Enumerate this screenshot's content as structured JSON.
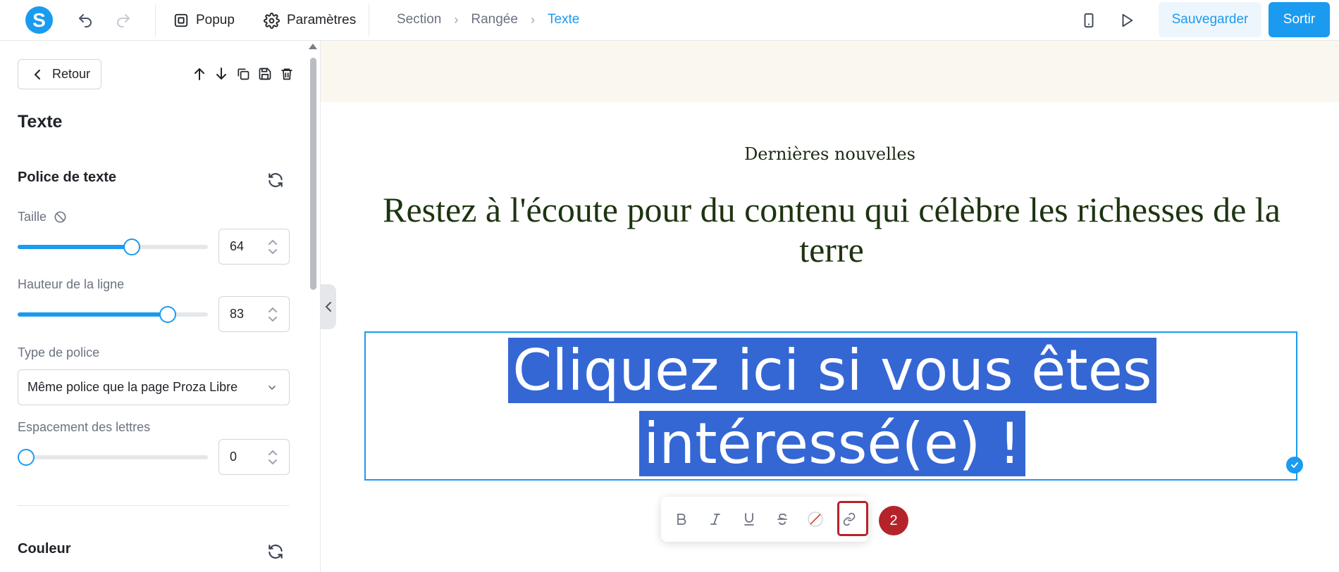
{
  "app": {
    "logo_letter": "S"
  },
  "toolbar": {
    "popup_label": "Popup",
    "settings_label": "Paramètres",
    "breadcrumb": [
      "Section",
      "Rangée",
      "Texte"
    ],
    "save_label": "Sauvegarder",
    "exit_label": "Sortir"
  },
  "panel": {
    "back_label": "Retour",
    "title": "Texte",
    "font_section": "Police de texte",
    "size_label": "Taille",
    "size_value": "64",
    "size_fraction": 0.6,
    "line_height_label": "Hauteur de la ligne",
    "line_height_value": "83",
    "line_height_fraction": 0.79,
    "font_type_label": "Type de police",
    "font_type_value": "Même police que la page Proza Libre",
    "letter_spacing_label": "Espacement des lettres",
    "letter_spacing_value": "0",
    "letter_spacing_fraction": 0,
    "color_section": "Couleur"
  },
  "canvas": {
    "eyebrow": "Dernières nouvelles",
    "headline": "Restez à l'écoute pour du contenu qui célèbre les richesses de la terre",
    "cta_line1": "Cliquez ici si vous êtes ",
    "cta_line2": "intéressé(e) !",
    "step_number": "2"
  },
  "colors": {
    "accent": "#1a9bf0",
    "selection": "#3467d4",
    "highlight": "#b5232a"
  }
}
